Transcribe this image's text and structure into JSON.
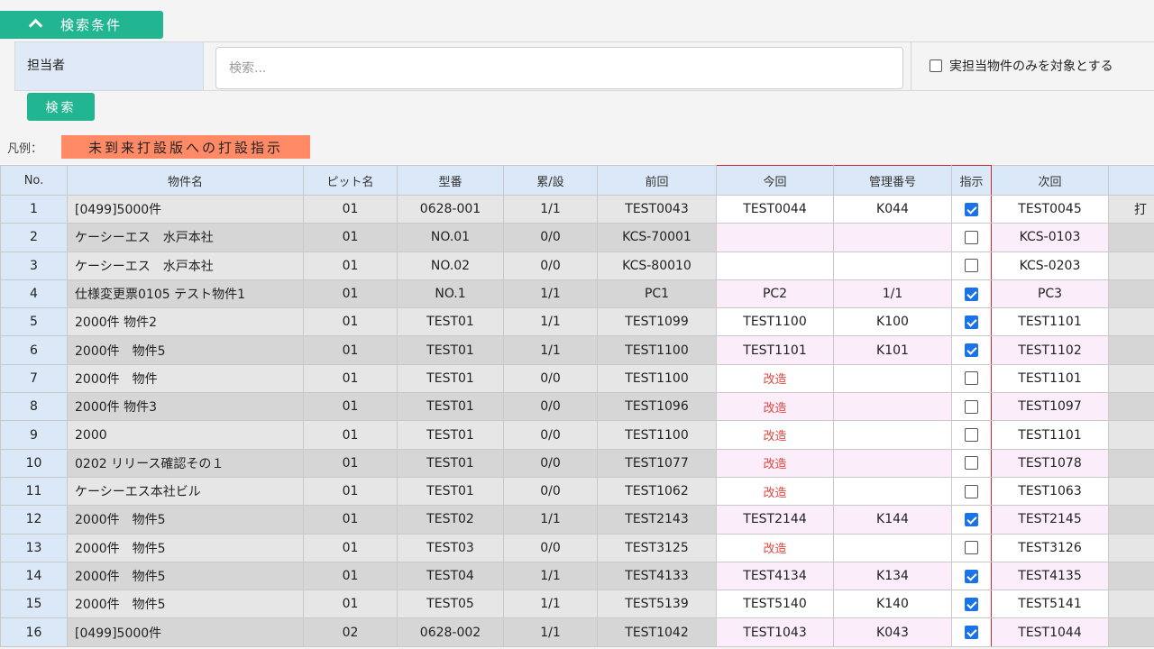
{
  "header": {
    "toggle_label": "検索条件",
    "assignee_label": "担当者",
    "search_placeholder": "検索...",
    "only_mine_label": "実担当物件のみを対象とする",
    "search_button": "検索"
  },
  "legend": {
    "label": "凡例：",
    "chip": "未到来打設版への打設指示"
  },
  "colors": {
    "accent": "#21b591",
    "legend_chip": "#ff8a65",
    "header_bg": "#dbe8f8",
    "highlight_pink": "#fbeefa",
    "red_text": "#e0443c",
    "red_frame": "#d9262c",
    "check_blue": "#1a73e8"
  },
  "table": {
    "columns": [
      "No.",
      "物件名",
      "ピット名",
      "型番",
      "累/設",
      "前回",
      "今回",
      "管理番号",
      "指示",
      "次回",
      ""
    ],
    "last_col_first_cell": "打",
    "rows": [
      {
        "no": "1",
        "name": "[0499]5000件",
        "pit": "01",
        "model": "0628-001",
        "ratio": "1/1",
        "prev": "TEST0043",
        "curr": "TEST0044",
        "mgmt": "K044",
        "checked": true,
        "next": "TEST0045",
        "pink": false
      },
      {
        "no": "2",
        "name": "ケーシーエス　水戸本社",
        "pit": "01",
        "model": "NO.01",
        "ratio": "0/0",
        "prev": "KCS-70001",
        "curr": "",
        "mgmt": "",
        "checked": false,
        "next": "KCS-0103",
        "pink": true
      },
      {
        "no": "3",
        "name": "ケーシーエス　水戸本社",
        "pit": "01",
        "model": "NO.02",
        "ratio": "0/0",
        "prev": "KCS-80010",
        "curr": "",
        "mgmt": "",
        "checked": false,
        "next": "KCS-0203",
        "pink": false
      },
      {
        "no": "4",
        "name": "仕様変更票0105 テスト物件1",
        "pit": "01",
        "model": "NO.1",
        "ratio": "1/1",
        "prev": "PC1",
        "curr": "PC2",
        "mgmt": "1/1",
        "checked": true,
        "next": "PC3",
        "pink": true
      },
      {
        "no": "5",
        "name": "2000件 物件2",
        "pit": "01",
        "model": "TEST01",
        "ratio": "1/1",
        "prev": "TEST1099",
        "curr": "TEST1100",
        "mgmt": "K100",
        "checked": true,
        "next": "TEST1101",
        "pink": false
      },
      {
        "no": "6",
        "name": "2000件　物件5",
        "pit": "01",
        "model": "TEST01",
        "ratio": "1/1",
        "prev": "TEST1100",
        "curr": "TEST1101",
        "mgmt": "K101",
        "checked": true,
        "next": "TEST1102",
        "pink": true
      },
      {
        "no": "7",
        "name": "2000件　物件",
        "pit": "01",
        "model": "TEST01",
        "ratio": "0/0",
        "prev": "TEST1100",
        "curr": "改造",
        "mgmt": "",
        "checked": false,
        "next": "TEST1101",
        "pink": false,
        "red": true
      },
      {
        "no": "8",
        "name": "2000件 物件3",
        "pit": "01",
        "model": "TEST01",
        "ratio": "0/0",
        "prev": "TEST1096",
        "curr": "改造",
        "mgmt": "",
        "checked": false,
        "next": "TEST1097",
        "pink": true,
        "red": true
      },
      {
        "no": "9",
        "name": "2000",
        "pit": "01",
        "model": "TEST01",
        "ratio": "0/0",
        "prev": "TEST1100",
        "curr": "改造",
        "mgmt": "",
        "checked": false,
        "next": "TEST1101",
        "pink": false,
        "red": true
      },
      {
        "no": "10",
        "name": "0202 リリース確認その１",
        "pit": "01",
        "model": "TEST01",
        "ratio": "0/0",
        "prev": "TEST1077",
        "curr": "改造",
        "mgmt": "",
        "checked": false,
        "next": "TEST1078",
        "pink": true,
        "red": true
      },
      {
        "no": "11",
        "name": "ケーシーエス本社ビル",
        "pit": "01",
        "model": "TEST01",
        "ratio": "0/0",
        "prev": "TEST1062",
        "curr": "改造",
        "mgmt": "",
        "checked": false,
        "next": "TEST1063",
        "pink": false,
        "red": true
      },
      {
        "no": "12",
        "name": "2000件　物件5",
        "pit": "01",
        "model": "TEST02",
        "ratio": "1/1",
        "prev": "TEST2143",
        "curr": "TEST2144",
        "mgmt": "K144",
        "checked": true,
        "next": "TEST2145",
        "pink": true
      },
      {
        "no": "13",
        "name": "2000件　物件5",
        "pit": "01",
        "model": "TEST03",
        "ratio": "0/0",
        "prev": "TEST3125",
        "curr": "改造",
        "mgmt": "",
        "checked": false,
        "next": "TEST3126",
        "pink": false,
        "red": true
      },
      {
        "no": "14",
        "name": "2000件　物件5",
        "pit": "01",
        "model": "TEST04",
        "ratio": "1/1",
        "prev": "TEST4133",
        "curr": "TEST4134",
        "mgmt": "K134",
        "checked": true,
        "next": "TEST4135",
        "pink": true
      },
      {
        "no": "15",
        "name": "2000件　物件5",
        "pit": "01",
        "model": "TEST05",
        "ratio": "1/1",
        "prev": "TEST5139",
        "curr": "TEST5140",
        "mgmt": "K140",
        "checked": true,
        "next": "TEST5141",
        "pink": false
      },
      {
        "no": "16",
        "name": "[0499]5000件",
        "pit": "02",
        "model": "0628-002",
        "ratio": "1/1",
        "prev": "TEST1042",
        "curr": "TEST1043",
        "mgmt": "K043",
        "checked": true,
        "next": "TEST1044",
        "pink": true
      }
    ]
  }
}
